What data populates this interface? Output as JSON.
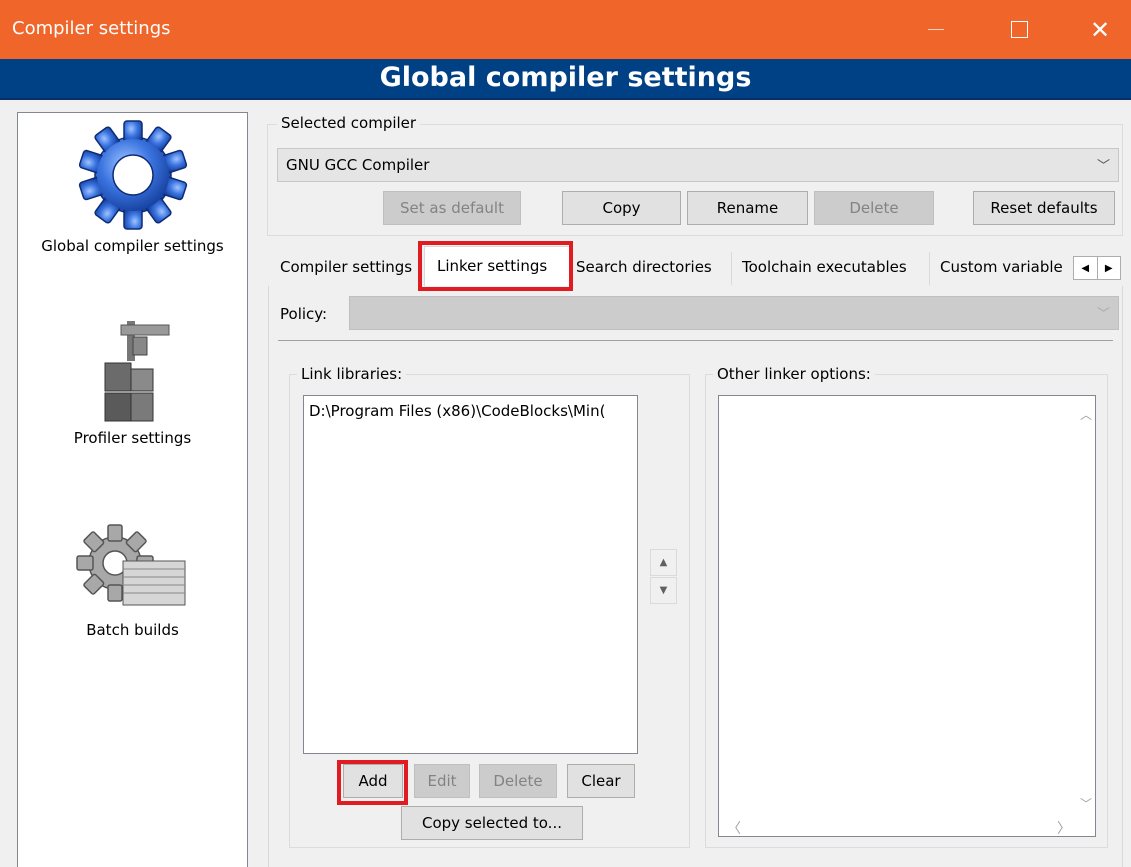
{
  "window": {
    "title": "Compiler settings",
    "banner": "Global compiler settings",
    "colors": {
      "titlebar": "#f0652a",
      "banner": "#004185",
      "highlight": "#e11b22"
    }
  },
  "sidebar": {
    "items": [
      {
        "label": "Global compiler settings",
        "icon": "gear-icon"
      },
      {
        "label": "Profiler settings",
        "icon": "caliper-icon"
      },
      {
        "label": "Batch builds",
        "icon": "batch-gear-icon"
      }
    ]
  },
  "selected_compiler": {
    "group_label": "Selected compiler",
    "value": "GNU GCC Compiler",
    "buttons": {
      "set_default": "Set as default",
      "copy": "Copy",
      "rename": "Rename",
      "delete": "Delete",
      "reset": "Reset defaults"
    }
  },
  "tabs": [
    {
      "label": "Compiler settings"
    },
    {
      "label": "Linker settings",
      "active": true
    },
    {
      "label": "Search directories"
    },
    {
      "label": "Toolchain executables"
    },
    {
      "label": "Custom variable"
    }
  ],
  "linker": {
    "policy_label": "Policy:",
    "link_libraries": {
      "label": "Link libraries:",
      "items": [
        "D:\\Program Files (x86)\\CodeBlocks\\Min("
      ],
      "buttons": {
        "add": "Add",
        "edit": "Edit",
        "delete": "Delete",
        "clear": "Clear",
        "copy_to": "Copy selected to..."
      }
    },
    "other_options": {
      "label": "Other linker options:"
    }
  }
}
